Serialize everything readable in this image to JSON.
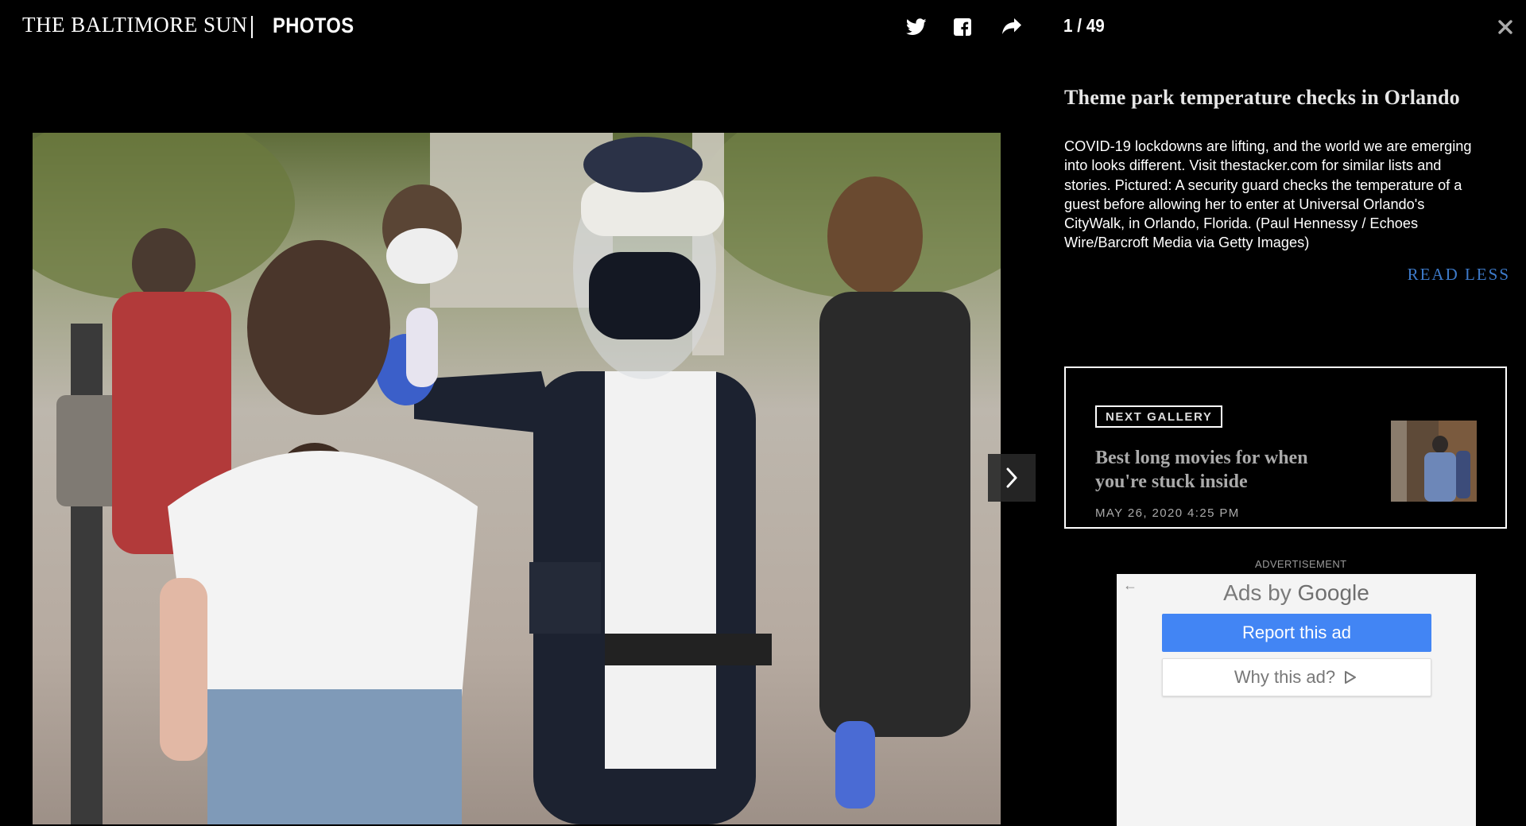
{
  "header": {
    "logo_text": "THE BALTIMORE SUN",
    "section_label": "PHOTOS",
    "counter": "1 / 49",
    "icons": [
      "twitter-icon",
      "facebook-icon",
      "share-icon",
      "close-icon"
    ]
  },
  "photo": {
    "alt": "Security guard checks the temperature of a guest"
  },
  "caption": {
    "title": "Theme park temperature checks in Orlando",
    "lines": [
      "COVID-19 lockdowns are lifting, and the world we are emerging",
      "into looks different. Visit thestacker.com for similar lists and",
      "stories. Pictured: A security guard checks the temperature of a",
      "guest before allowing her to enter at Universal Orlando's",
      "CityWalk, in Orlando, Florida. (Paul Hennessy / Echoes",
      "Wire/Barcroft Media via Getty Images)"
    ],
    "read_less": "READ LESS"
  },
  "next_gallery": {
    "badge": "NEXT GALLERY",
    "title_line1": "Best long movies for when",
    "title_line2": "you're stuck inside",
    "date": "MAY 26, 2020 4:25 PM"
  },
  "ad": {
    "label": "ADVERTISEMENT",
    "ads_by": "Ads by",
    "ads_brand": "Google",
    "report_label": "Report this ad",
    "why_label": "Why this ad?"
  },
  "colors": {
    "background": "#000000",
    "link_blue": "#3d7ac9",
    "google_blue": "#4285f4"
  }
}
